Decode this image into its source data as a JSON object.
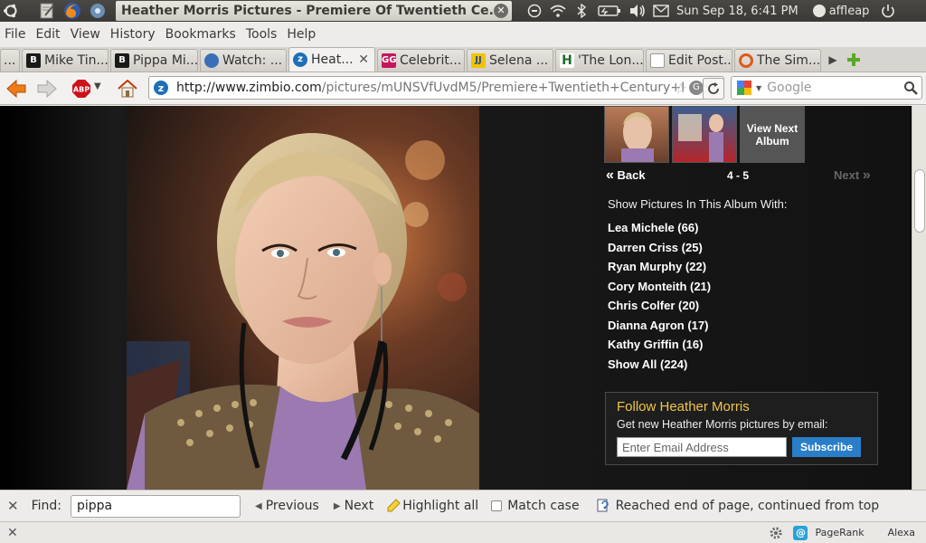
{
  "panel": {
    "window_title": "Heather Morris Pictures - Premiere Of Twentieth Ce...",
    "clock": "Sun Sep 18,  6:41 PM",
    "user": "affleap"
  },
  "menu": [
    "File",
    "Edit",
    "View",
    "History",
    "Bookmarks",
    "Tools",
    "Help"
  ],
  "tabs": [
    {
      "label": "...",
      "favicon": "overflow",
      "color": "#aaaaaa"
    },
    {
      "label": "Mike Tin...",
      "favicon": "B",
      "color": "#1a1a1a"
    },
    {
      "label": "Pippa Mi...",
      "favicon": "B",
      "color": "#1a1a1a"
    },
    {
      "label": "Watch: ...",
      "favicon": "globe",
      "color": "#3a6fb7"
    },
    {
      "label": "Heat...",
      "favicon": "zimbio",
      "color": "#1e6fb8",
      "active": true
    },
    {
      "label": "Celebrit...",
      "favicon": "GG",
      "color": "#c2185b"
    },
    {
      "label": "Selena ...",
      "favicon": "JJ",
      "color": "#f2c300"
    },
    {
      "label": "'The Lon...",
      "favicon": "H",
      "color": "#1b6e2a"
    },
    {
      "label": "Edit Post...",
      "favicon": "page",
      "color": "#ffffff"
    },
    {
      "label": "The Sim...",
      "favicon": "ring",
      "color": "#e05a1c"
    }
  ],
  "nav": {
    "url_host": "http://www.zimbio.com",
    "url_path": "/pictures/mUNSVfUvdM5/Premiere+Twentieth+Century+I",
    "search_placeholder": "Google"
  },
  "page": {
    "view_next": "View Next Album",
    "back": "Back",
    "range": "4 - 5",
    "next": "Next",
    "show_label": "Show Pictures In This Album With:",
    "people": [
      "Lea Michele (66)",
      "Darren Criss (25)",
      "Ryan Murphy (22)",
      "Cory Monteith (21)",
      "Chris Colfer (20)",
      "Dianna Agron (17)",
      "Kathy Griffin (16)",
      "Show All (224)"
    ],
    "follow": {
      "title": "Follow Heather Morris",
      "desc": "Get new Heather Morris pictures by email:",
      "email_placeholder": "Enter Email Address",
      "subscribe": "Subscribe"
    }
  },
  "findbar": {
    "find_label": "Find:",
    "query": "pippa",
    "previous": "Previous",
    "next": "Next",
    "highlight": "Highlight all",
    "match_case": "Match case",
    "status": "Reached end of page, continued from top"
  },
  "statusbar": {
    "pagerank": "PageRank",
    "alexa": "Alexa"
  }
}
